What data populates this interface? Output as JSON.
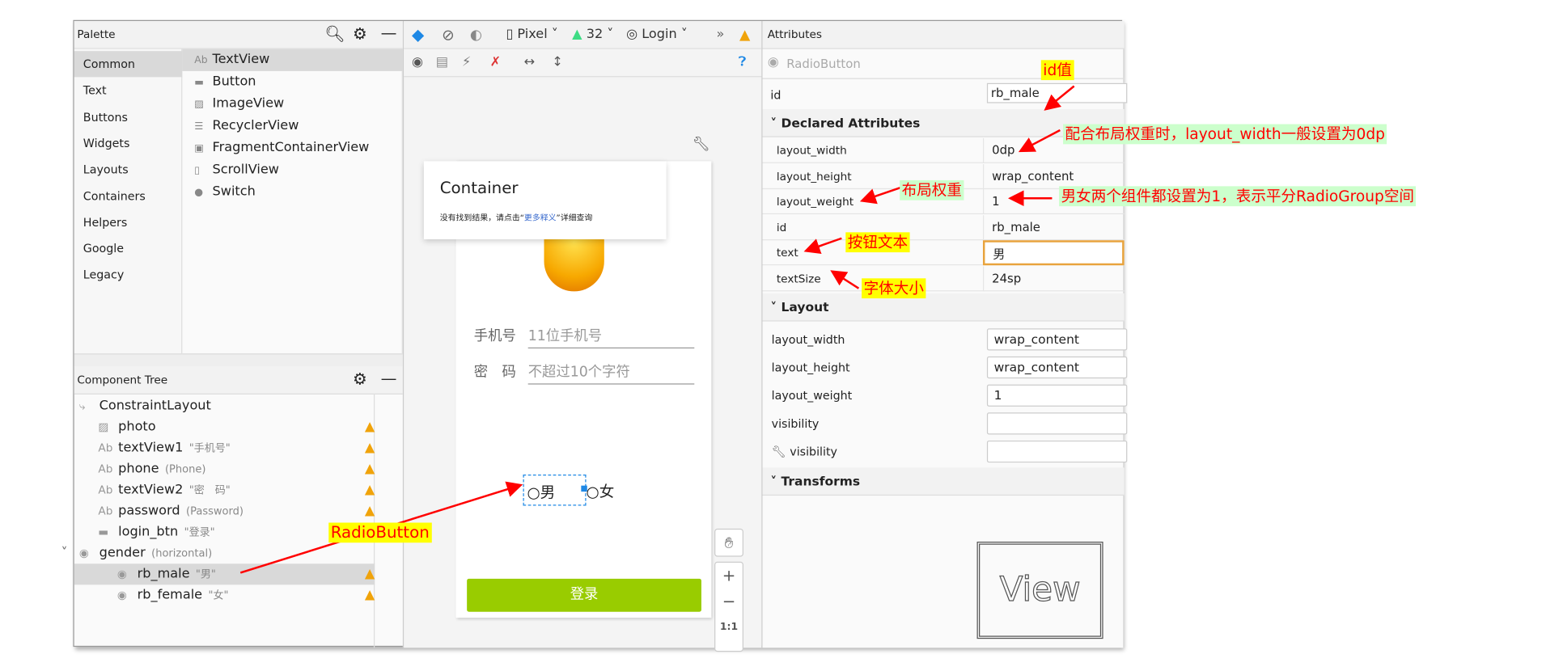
{
  "palette": {
    "title": "Palette",
    "categories": [
      "Common",
      "Text",
      "Buttons",
      "Widgets",
      "Layouts",
      "Containers",
      "Helpers",
      "Google",
      "Legacy"
    ],
    "items": [
      {
        "icon": "Ab",
        "label": "TextView"
      },
      {
        "icon": "▬",
        "label": "Button"
      },
      {
        "icon": "▨",
        "label": "ImageView"
      },
      {
        "icon": "☰",
        "label": "RecyclerView"
      },
      {
        "icon": "▣",
        "label": "FragmentContainerView"
      },
      {
        "icon": "▯",
        "label": "ScrollView"
      },
      {
        "icon": "●",
        "label": "Switch"
      }
    ]
  },
  "component_tree": {
    "title": "Component Tree",
    "nodes": [
      {
        "icon": "⤷",
        "label": "ConstraintLayout",
        "sub": ""
      },
      {
        "icon": "▨",
        "label": "photo",
        "sub": ""
      },
      {
        "icon": "Ab",
        "label": "textView1",
        "sub": "\"手机号\""
      },
      {
        "icon": "Ab",
        "label": "phone",
        "sub": "(Phone)"
      },
      {
        "icon": "Ab",
        "label": "textView2",
        "sub": "\"密　码\""
      },
      {
        "icon": "Ab",
        "label": "password",
        "sub": "(Password)"
      },
      {
        "icon": "▬",
        "label": "login_btn",
        "sub": "\"登录\""
      },
      {
        "icon": "◉",
        "label": "gender",
        "sub": "(horizontal)"
      },
      {
        "icon": "◉",
        "label": "rb_male",
        "sub": "\"男\""
      },
      {
        "icon": "◉",
        "label": "rb_female",
        "sub": "\"女\""
      }
    ]
  },
  "toolbar": {
    "device": "Pixel",
    "api": "32",
    "theme": "Login"
  },
  "canvas": {
    "popup_title": "Container",
    "popup_text_a": "没有找到结果，请点击“",
    "popup_link": "更多释义",
    "popup_text_b": "”详细查询",
    "phone_label": "手机号",
    "phone_hint": "11位手机号",
    "pwd_label": "密　码",
    "pwd_hint": "不超过10个字符",
    "radio_male": "男",
    "radio_female": "女",
    "login_button": "登录",
    "zoom_reset": "1:1"
  },
  "attributes": {
    "title": "Attributes",
    "component": "RadioButton",
    "id_label": "id",
    "id_value": "rb_male",
    "declared_title": "Declared Attributes",
    "declared": [
      {
        "k": "layout_width",
        "v": "0dp"
      },
      {
        "k": "layout_height",
        "v": "wrap_content"
      },
      {
        "k": "layout_weight",
        "v": "1"
      },
      {
        "k": "id",
        "v": "rb_male"
      },
      {
        "k": "text",
        "v": "男"
      },
      {
        "k": "textSize",
        "v": "24sp"
      }
    ],
    "layout_title": "Layout",
    "layout": [
      {
        "k": "layout_width",
        "v": "wrap_content"
      },
      {
        "k": "layout_height",
        "v": "wrap_content"
      },
      {
        "k": "layout_weight",
        "v": "1"
      },
      {
        "k": "visibility",
        "v": ""
      },
      {
        "k": "visibility",
        "v": ""
      }
    ],
    "transforms_title": "Transforms",
    "view_preview": "View"
  },
  "annotations": {
    "id": "id值",
    "width": "配合布局权重时，layout_width一般设置为0dp",
    "weight": "布局权重",
    "weight_value": "男女两个组件都设置为1，表示平分RadioGroup空间",
    "text": "按钮文本",
    "textsize": "字体大小",
    "radiobutton": "RadioButton"
  },
  "colors": {
    "accent": "#1e88e5",
    "login": "#99cc00",
    "warning": "#f0a30a",
    "annotation": "#ff0000",
    "highlight": "#ffff00",
    "note_bg": "#ccffcc"
  }
}
